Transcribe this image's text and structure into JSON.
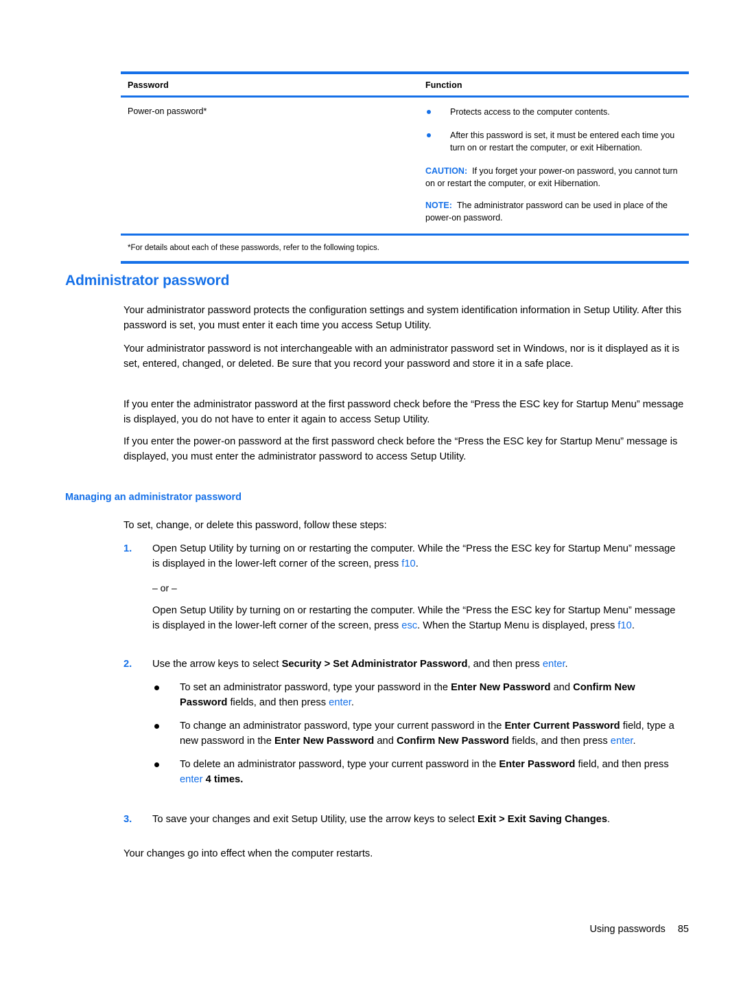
{
  "table": {
    "headers": {
      "password": "Password",
      "function": "Function"
    },
    "row": {
      "password_label": "Power-on password*",
      "bullets": [
        "Protects access to the computer contents.",
        "After this password is set, it must be entered each time you turn on or restart the computer, or exit Hibernation."
      ],
      "caution": {
        "label": "CAUTION:",
        "text": "If you forget your power-on password, you cannot turn on or restart the computer, or exit Hibernation."
      },
      "note": {
        "label": "NOTE:",
        "text": "The administrator password can be used in place of the power-on password."
      }
    },
    "footnote": "*For details about each of these passwords, refer to the following topics."
  },
  "section": {
    "title": "Administrator password",
    "subtitle": "Managing an administrator password",
    "paragraphs": {
      "p1": "Your administrator password protects the configuration settings and system identification information in Setup Utility. After this password is set, you must enter it each time you access Setup Utility.",
      "p2": "Your administrator password is not interchangeable with an administrator password set in Windows, nor is it displayed as it is set, entered, changed, or deleted. Be sure that you record your password and store it in a safe place.",
      "p3": "If you enter the administrator password at the first password check before the “Press the ESC key for Startup Menu” message is displayed, you do not have to enter it again to access Setup Utility.",
      "p4": "If you enter the power-on password at the first password check before the “Press the ESC key for Startup Menu” message is displayed, you must enter the administrator password to access Setup Utility.",
      "intro": "To set, change, or delete this password, follow these steps:",
      "final": "Your changes go into effect when the computer restarts."
    }
  },
  "steps": {
    "step1": {
      "number": "1.",
      "text_a": "Open Setup Utility by turning on or restarting the computer. While the “Press the ESC key for Startup Menu” message is displayed in the lower-left corner of the screen, press ",
      "key_f10": "f10",
      "text_b": "."
    },
    "or_separator": "– or –",
    "step1_alt": {
      "text_a": "Open Setup Utility by turning on or restarting the computer. While the “Press the ESC key for Startup Menu” message is displayed in the lower-left corner of the screen, press ",
      "key_esc": "esc",
      "text_b": ". When the Startup Menu is displayed, press ",
      "key_f10": "f10",
      "text_c": "."
    },
    "step2": {
      "number": "2.",
      "text_a": "Use the arrow keys to select ",
      "bold_a": "Security > Set Administrator Password",
      "text_b": ", and then press ",
      "key_enter": "enter",
      "text_c": "."
    },
    "bullets": [
      {
        "text_a": "To set an administrator password, type your password in the ",
        "bold_a": "Enter New Password",
        "text_b": " and ",
        "bold_b": "Confirm New Password",
        "text_c": " fields, and then press ",
        "key_enter": "enter",
        "text_d": "."
      },
      {
        "text_a": "To change an administrator password, type your current password in the ",
        "bold_a": "Enter Current Password",
        "text_b": " field, type a new password in the ",
        "bold_b": "Enter New Password",
        "text_c": " and ",
        "bold_c": "Confirm New Password",
        "text_d": " fields, and then press ",
        "key_enter": "enter",
        "text_e": "."
      },
      {
        "text_a": "To delete an administrator password, type your current password in the ",
        "bold_a": "Enter Password",
        "text_b": " field, and then press ",
        "key_enter": "enter",
        "text_c": " ",
        "bold_b": "4 times."
      }
    ],
    "step3": {
      "number": "3.",
      "text_a": "To save your changes and exit Setup Utility, use the arrow keys to select ",
      "bold_a": "Exit > Exit Saving Changes",
      "text_b": "."
    }
  },
  "footer": {
    "label": "Using passwords",
    "page": "85"
  },
  "colors": {
    "accent_blue": "#1570e8",
    "text_black": "#000000"
  }
}
